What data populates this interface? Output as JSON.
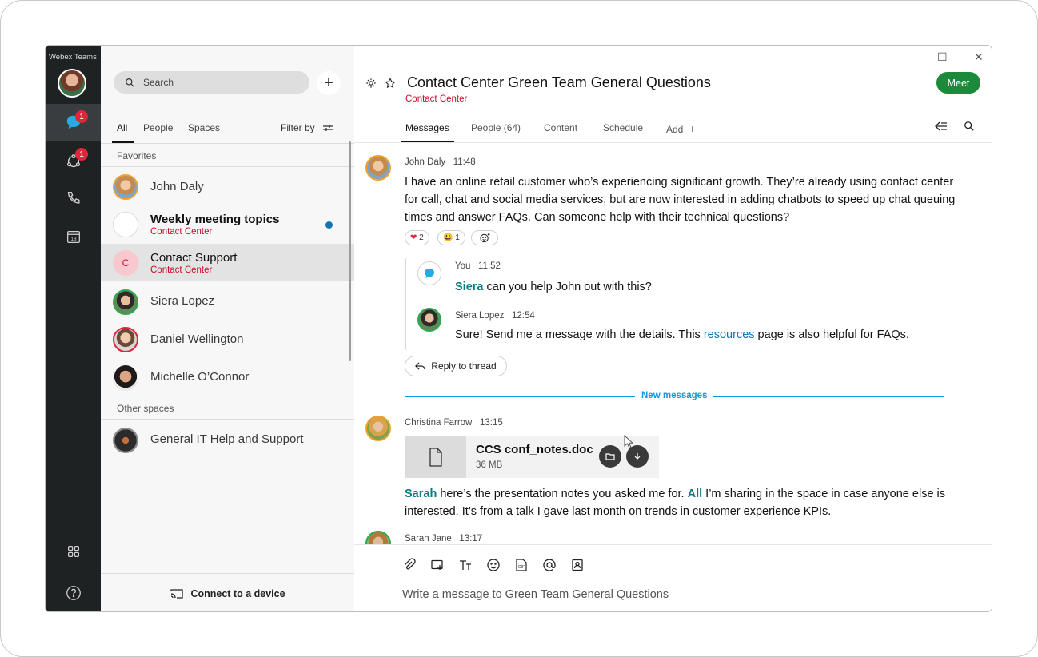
{
  "app": {
    "title": "Webex Teams"
  },
  "rail": {
    "messages_badge": "1",
    "teams_badge": "1",
    "calendar_day": "18"
  },
  "sidebar": {
    "search_placeholder": "Search",
    "add_label": "+",
    "filters": [
      "All",
      "People",
      "Spaces"
    ],
    "filter_by": "Filter by",
    "favorites_label": "Favorites",
    "other_spaces_label": "Other spaces",
    "contacts": [
      {
        "name": "John Daly",
        "sub": ""
      },
      {
        "name": "Weekly meeting topics",
        "sub": "Contact Center"
      },
      {
        "name": "Contact Support",
        "sub": "Contact Center",
        "initial": "C"
      },
      {
        "name": "Siera Lopez",
        "sub": ""
      },
      {
        "name": "Daniel Wellington",
        "sub": ""
      },
      {
        "name": "Michelle O’Connor",
        "sub": ""
      }
    ],
    "other_spaces": [
      {
        "name": "General IT Help and Support"
      }
    ],
    "connect_device": "Connect to a device"
  },
  "header": {
    "title": "Contact Center Green Team General Questions",
    "subtitle": "Contact Center",
    "meet_button": "Meet",
    "window_controls": [
      "–",
      "☐",
      "✕"
    ]
  },
  "tabs": {
    "messages": "Messages",
    "people": "People (64)",
    "content": "Content",
    "schedule": "Schedule",
    "add": "Add",
    "add_icon": "+"
  },
  "messages": [
    {
      "author": "John Daly",
      "time": "11:48",
      "lines": [
        "I have an online retail customer who’s experiencing significant growth. They’re already using contact center",
        "for call, chat and social media services, but are now interested in adding chatbots to speed up chat queuing",
        "times and answer FAQs. Can someone help with their technical questions?"
      ],
      "reactions": [
        {
          "emoji": "❤",
          "count": "2"
        },
        {
          "emoji": "😃",
          "count": "1"
        }
      ]
    }
  ],
  "thread": [
    {
      "author": "You",
      "time": "11:52",
      "mention": "Siera",
      "text": " can you help John out with this?"
    },
    {
      "author": "Siera Lopez",
      "time": "12:54",
      "text_before": "Sure! Send me a message with the details. This ",
      "link": "resources",
      "text_after": " page is also helpful for FAQs."
    }
  ],
  "reply_to_thread": "Reply to thread",
  "new_messages_label": "New messages",
  "file_message": {
    "author": "Christina Farrow",
    "time": "13:15",
    "file_name": "CCS conf_notes.doc",
    "file_size": "36 MB",
    "mention1": "Sarah",
    "text1": " here’s the presentation notes you asked me for.  ",
    "mention2": "All",
    "text2": " I’m sharing in the space in case anyone else is",
    "line2": "interested. It’s from a talk I gave last month on trends in customer experience KPIs."
  },
  "last_message": {
    "author": "Sarah Jane",
    "time": "13:17"
  },
  "composer": {
    "placeholder": "Write a message to Green Team General Questions"
  },
  "colors": {
    "accent_green": "#1b8a3a",
    "brand_red": "#c8102e",
    "link_blue": "#0d76b5",
    "new_msg_blue": "#0d9ad8"
  }
}
